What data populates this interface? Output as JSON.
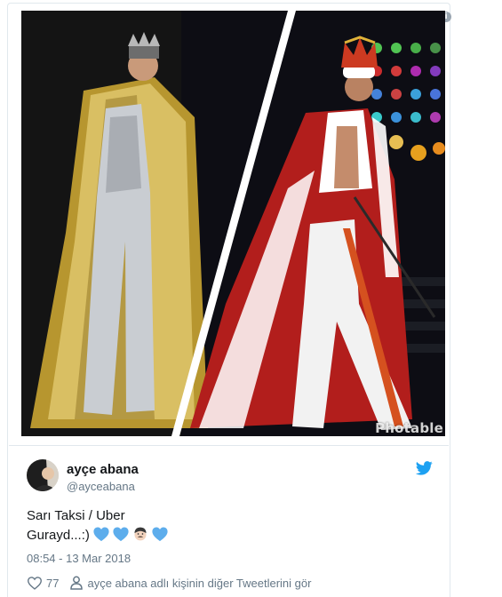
{
  "photo": {
    "watermark": "Photable",
    "alt_icon": "info-icon"
  },
  "tweet": {
    "author_name": "ayçe abana",
    "author_handle": "@ayceabana",
    "text_line1": "Sarı Taksi / Uber",
    "text_line2": "Gurayd...:)",
    "emojis": [
      "blue-heart",
      "blue-heart",
      "man-face",
      "blue-heart"
    ],
    "timestamp": "08:54 - 13 Mar 2018",
    "like_count": "77",
    "more_tweets_label": "ayçe abana adlı kişinin diğer Tweetlerini gör"
  },
  "colors": {
    "twitter_blue": "#1da1f2",
    "heart_blue": "#5dadec",
    "muted_text": "#657786",
    "border": "#e1e8ed"
  }
}
